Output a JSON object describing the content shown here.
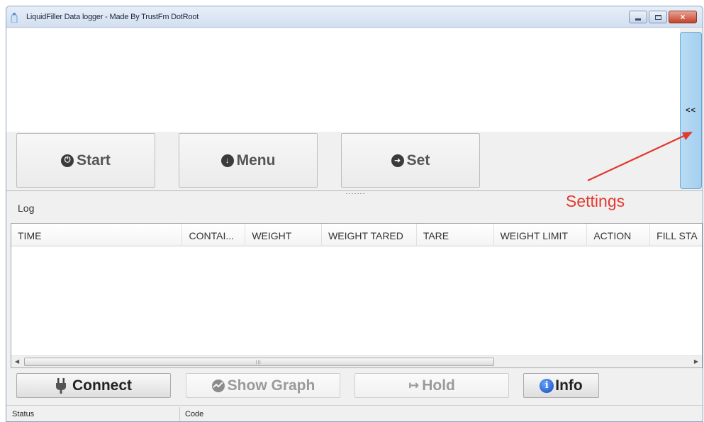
{
  "window": {
    "title": "LiquidFiller Data logger - Made By TrustFm DotRoot",
    "close_glyph": "×"
  },
  "settings_tab": {
    "label": "<<"
  },
  "annotation": {
    "text": "Settings",
    "color": "#e23a2e"
  },
  "top_buttons": [
    {
      "label": "Start",
      "icon": "power-icon"
    },
    {
      "label": "Menu",
      "icon": "arrow-down-circle-icon"
    },
    {
      "label": "Set",
      "icon": "arrow-right-circle-icon"
    }
  ],
  "log": {
    "label": "Log",
    "columns": [
      "TIME",
      "CONTAI...",
      "WEIGHT",
      "WEIGHT TARED",
      "TARE",
      "WEIGHT LIMIT",
      "ACTION",
      "FILL STA"
    ],
    "rows": []
  },
  "bottom_buttons": {
    "connect": "Connect",
    "show_graph": "Show Graph",
    "hold": "Hold",
    "info": "Info",
    "info_glyph": "i",
    "hold_glyph": "↦"
  },
  "status_bar": {
    "status": "Status",
    "code": "Code"
  }
}
